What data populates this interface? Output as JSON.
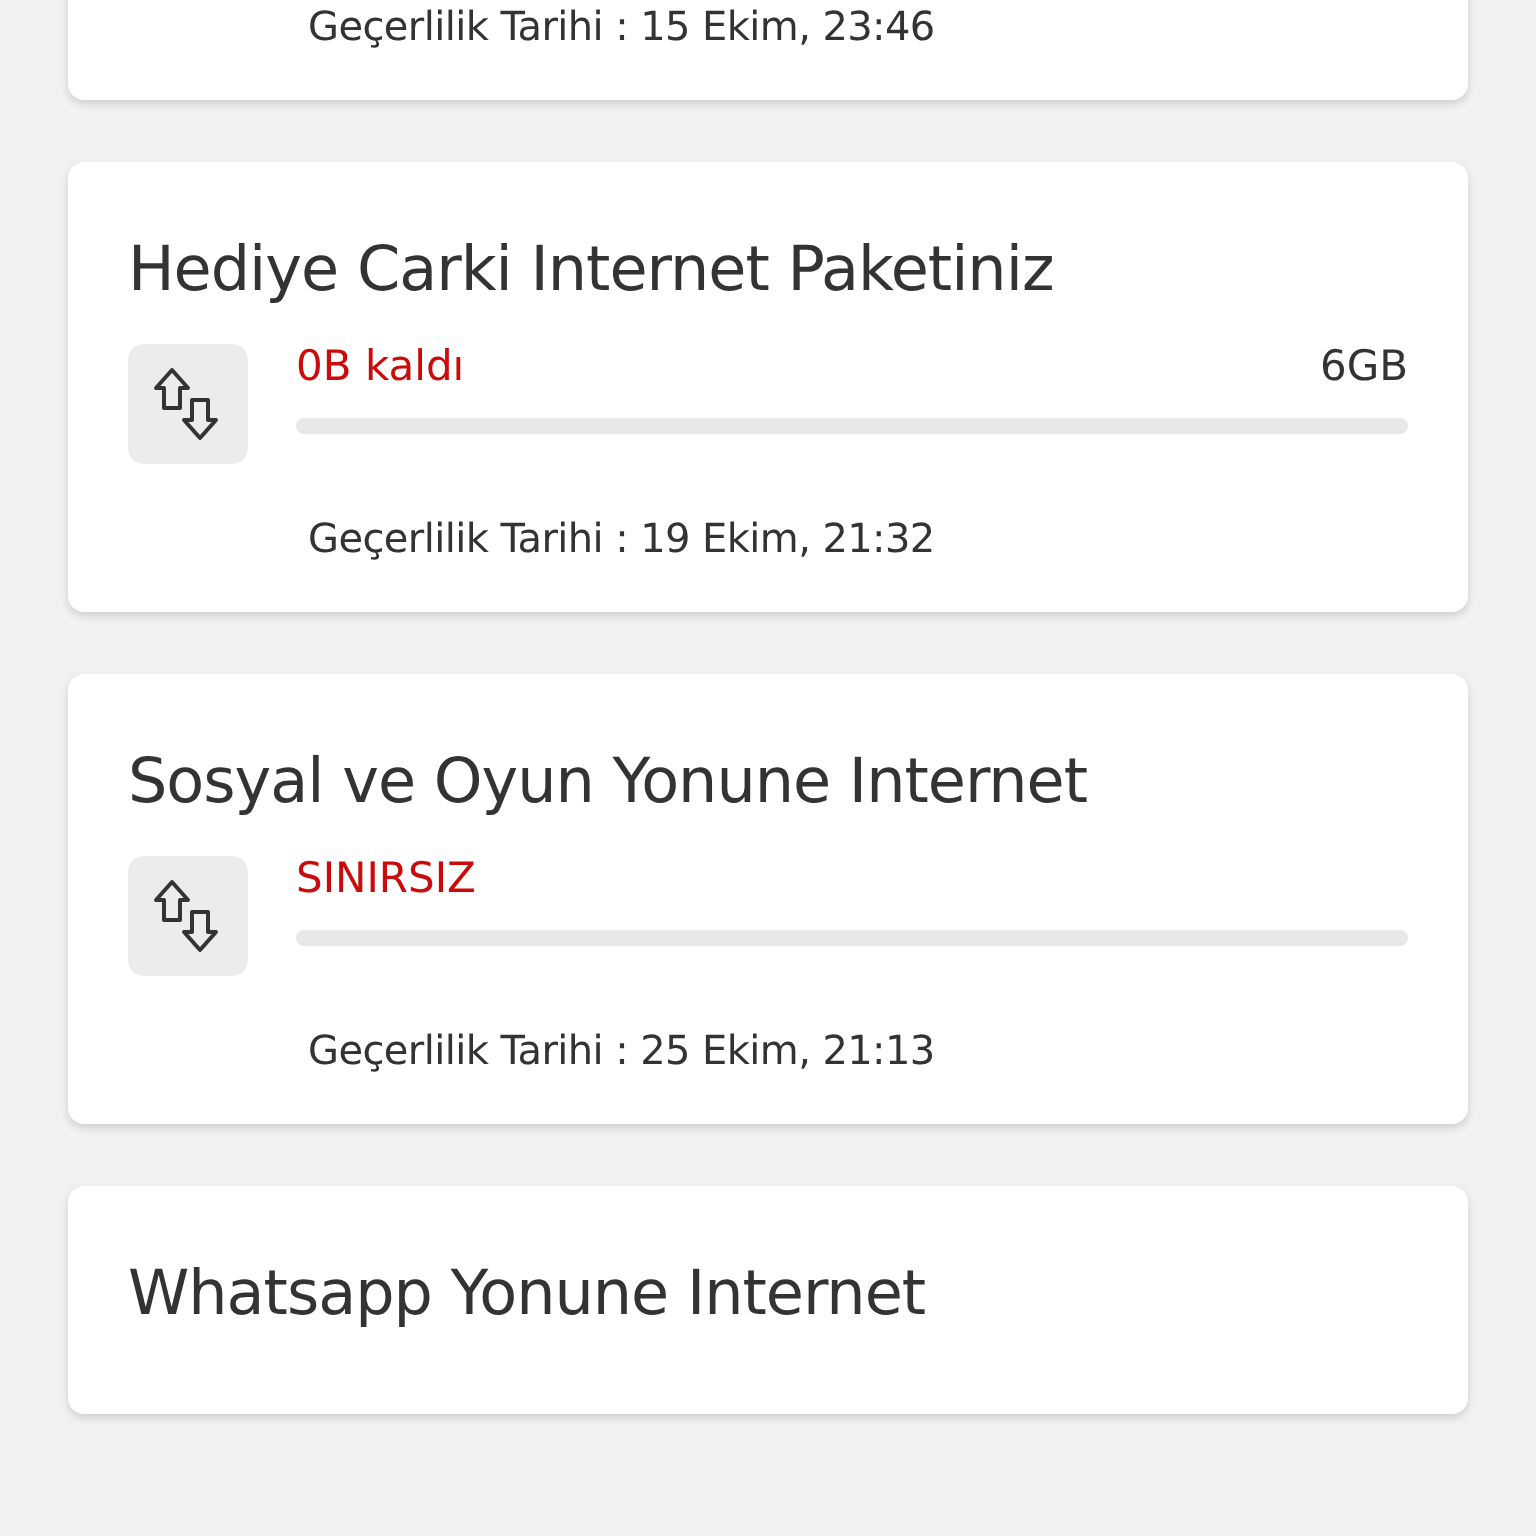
{
  "packages": [
    {
      "validity": "Geçerlilik Tarihi : 15 Ekim, 23:46"
    },
    {
      "title": "Hediye Carki Internet Paketiniz",
      "remaining": "0B kaldı",
      "total": "6GB",
      "level": 0,
      "validity": "Geçerlilik Tarihi : 19 Ekim, 21:32"
    },
    {
      "title": "Sosyal ve Oyun Yonune Internet",
      "remaining": "SINIRSIZ",
      "level": 0,
      "validity": "Geçerlilik Tarihi : 25 Ekim, 21:13"
    },
    {
      "title": "Whatsapp Yonune Internet"
    }
  ]
}
